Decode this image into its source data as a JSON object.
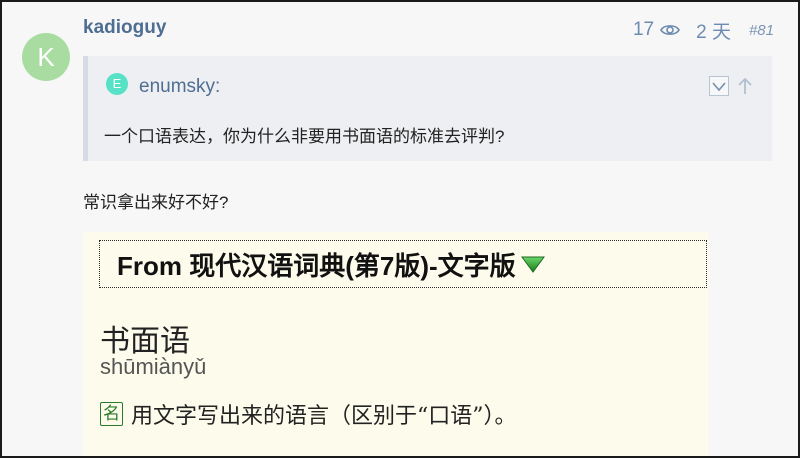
{
  "post": {
    "avatar_letter": "K",
    "username": "kadioguy",
    "views": "17",
    "ago": "2 天",
    "post_number": "#81",
    "body_text": "常识拿出来好不好?"
  },
  "quote": {
    "avatar_letter": "E",
    "username": "enumsky:",
    "text": "一个口语表达，你为什么非要用书面语的标准去评判?"
  },
  "dictionary": {
    "header": "From 现代汉语词典(第7版)-文字版",
    "headword": "书面语",
    "pinyin": "shūmiànyǔ",
    "pos": "名",
    "definition": "用文字写出来的语言（区别于“口语”）。"
  },
  "colors": {
    "username": "#4e6e92",
    "avatar_bg": "#a8dca0",
    "quote_avatar_bg": "#57e2c8",
    "dict_bg": "#fdfcec",
    "pos_tag": "#2a7a2a"
  }
}
